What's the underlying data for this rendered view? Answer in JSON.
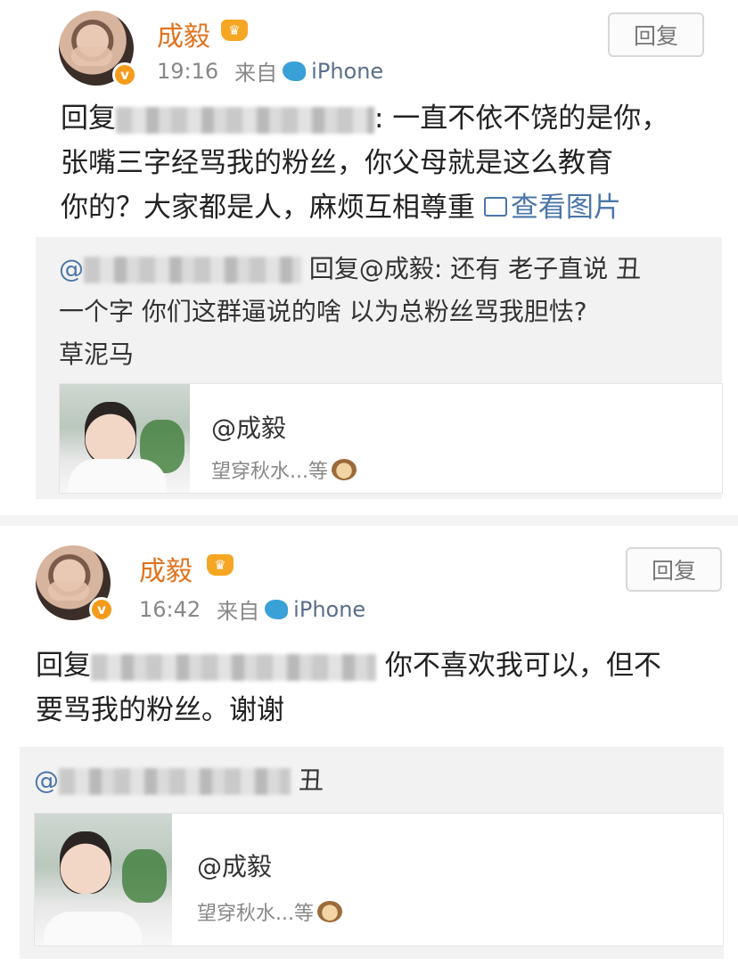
{
  "posts": [
    {
      "username": "成毅",
      "time": "19:16",
      "source_prefix": "来自",
      "device": "iPhone",
      "reply_button": "回复",
      "body": {
        "prefix": "回复",
        "after_blur": ": 一直不依不饶的是你，",
        "line2": "张嘴三字经骂我的粉丝，你父母就是这么教育",
        "line3": "你的？大家都是人，麻烦互相尊重",
        "view_image": "查看图片"
      },
      "quote": {
        "at": "@",
        "after_blur": "回复@成毅: 还有 老子直说 丑",
        "line2": "一个字 你们这群逼说的啥 以为总粉丝骂我胆怯?",
        "line3": "草泥马"
      },
      "card": {
        "title": "@成毅",
        "subtitle": "望穿秋水...等"
      }
    },
    {
      "username": "成毅",
      "time": "16:42",
      "source_prefix": "来自",
      "device": "iPhone",
      "reply_button": "回复",
      "body": {
        "prefix": "回复",
        "after_blur": " 你不喜欢我可以，但不",
        "line2": "要骂我的粉丝。谢谢"
      },
      "quote": {
        "at": "@",
        "after_blur": "丑"
      },
      "card": {
        "title": "@成毅",
        "subtitle": "望穿秋水...等"
      }
    }
  ]
}
